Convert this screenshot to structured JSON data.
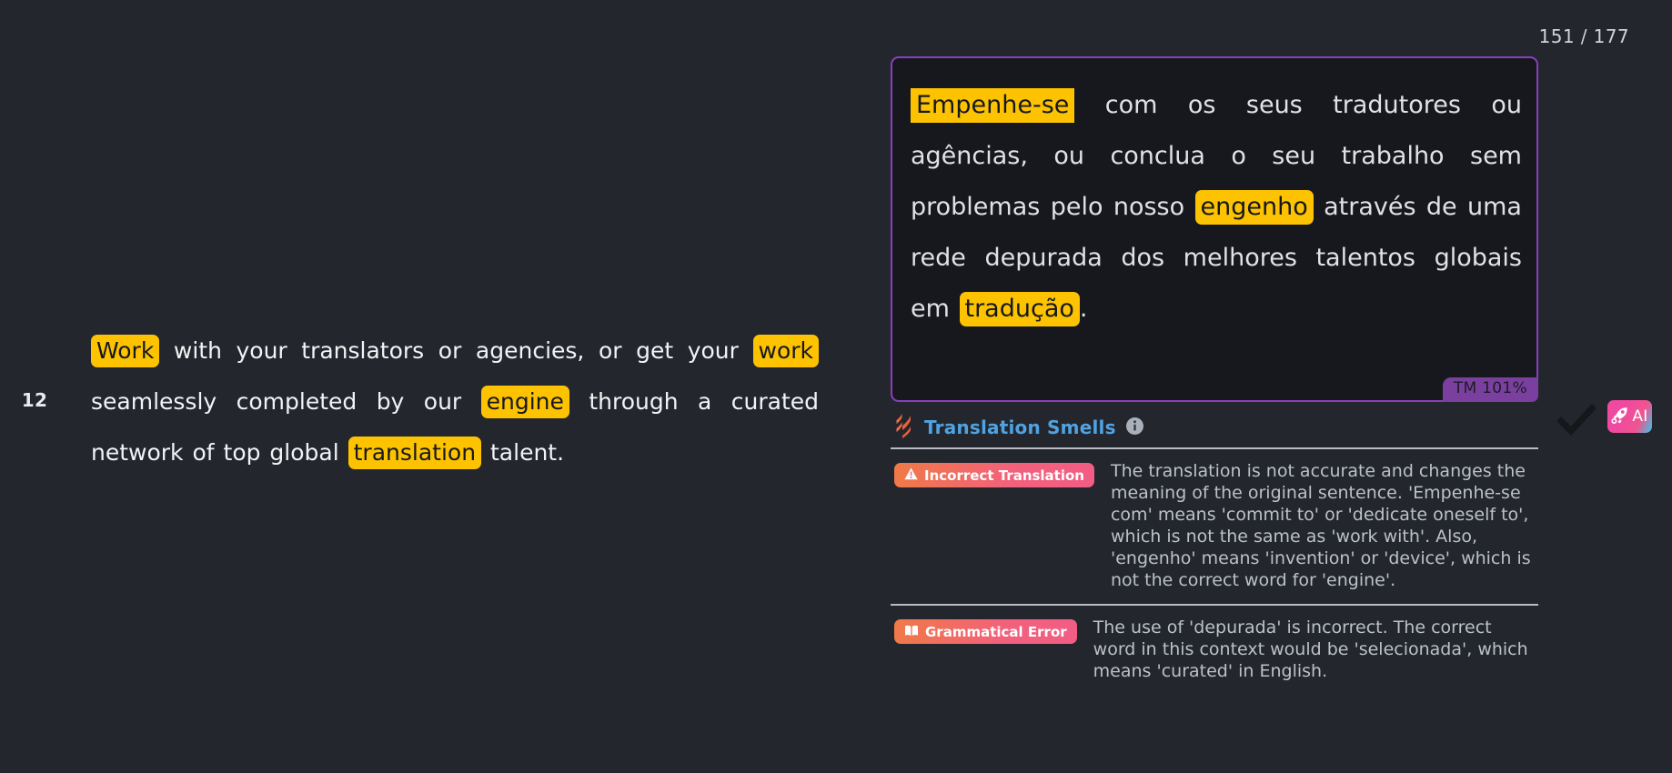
{
  "segment": {
    "row_number": "12",
    "counter": "151 / 177"
  },
  "source": {
    "line1_pre": "",
    "tokens": [
      {
        "text": "Work",
        "highlight": true
      },
      {
        "text": " with your translators or agencies, or get your ",
        "highlight": false
      },
      {
        "text": "work",
        "highlight": true
      },
      {
        "text": " seamlessly completed by our ",
        "highlight": false
      },
      {
        "text": "engine",
        "highlight": true
      },
      {
        "text": " through a curated network of top global ",
        "highlight": false
      },
      {
        "text": "translation",
        "highlight": true
      },
      {
        "text": " talent.",
        "highlight": false
      }
    ],
    "full_text": "Work with your translators or agencies, or get your work seamlessly completed by our engine through a curated network of top global translation talent."
  },
  "target": {
    "tokens": [
      {
        "text": "Empenhe-se",
        "highlight": true,
        "active": true
      },
      {
        "text": " com os seus tradutores ou agências, ou conclua o seu trabalho sem problemas pelo nosso ",
        "highlight": false
      },
      {
        "text": "engenho",
        "highlight": true
      },
      {
        "text": " através de uma rede depurada dos melhores talentos globais em ",
        "highlight": false
      },
      {
        "text": "tradução",
        "highlight": true
      },
      {
        "text": ".",
        "highlight": false
      }
    ],
    "full_text": "Empenhe-se com os seus tradutores ou agências, ou conclua o seu trabalho sem problemas pelo nosso engenho através de uma rede depurada dos melhores talentos globais em tradução.",
    "tm_badge": "TM 101%"
  },
  "smells": {
    "icon": "flame-icon",
    "title": "Translation Smells",
    "info_icon": "info-circle-icon",
    "items": [
      {
        "badge_label": "Incorrect Translation",
        "badge_icon": "warning-triangle-icon",
        "description": "The translation is not accurate and changes the meaning of the original sentence. 'Empenhe-se com' means 'commit to' or 'dedicate oneself to', which is not the same as 'work with'. Also, 'engenho' means 'invention' or 'device', which is not the correct word for 'engine'."
      },
      {
        "badge_label": "Grammatical Error",
        "badge_icon": "open-book-icon",
        "description": "The use of 'depurada' is incorrect. The correct word in this context would be 'selecionada', which means 'curated' in English."
      }
    ]
  },
  "actions": {
    "confirm_icon": "checkmark-icon",
    "ai_label": "AI",
    "ai_icon": "rocket-icon"
  },
  "colors": {
    "page_bg": "#23262d",
    "editor_bg": "#16181d",
    "editor_border": "#8b3fbe",
    "highlight": "#fdc300",
    "tm_badge": "#7b3fa0",
    "smells_title": "#4fa3e3",
    "badge_gradient_start": "#f07a47",
    "badge_gradient_end": "#f25d84",
    "flame": "#ef6c45"
  }
}
